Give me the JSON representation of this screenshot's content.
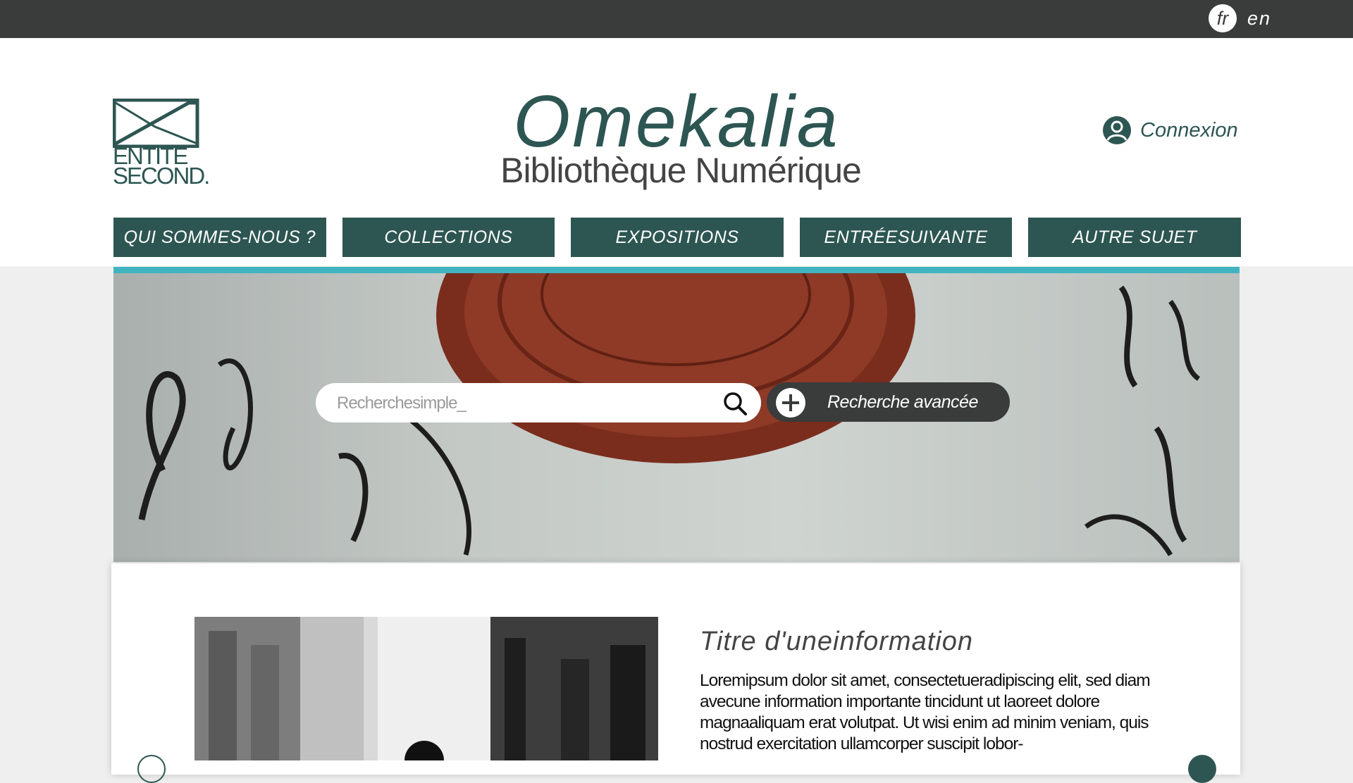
{
  "topbar": {
    "languages": [
      "fr",
      "en"
    ],
    "active_language": "fr"
  },
  "header": {
    "logo": {
      "line1": "ENTITE",
      "line2": "SECOND."
    },
    "title": "Omekalia",
    "subtitle": "Bibliothèque Numérique",
    "login_label": "Connexion"
  },
  "nav": {
    "items": [
      "QUI SOMMES-NOUS ?",
      "COLLECTIONS",
      "EXPOSITIONS",
      "ENTRÉESUIVANTE",
      "AUTRE SUJET"
    ]
  },
  "search": {
    "placeholder": "Recherchesimple_",
    "advanced_label": "Recherche avancée"
  },
  "news": {
    "title": "Titre d'uneinformation",
    "body": "Loremipsum dolor sit amet, consectetueradipiscing elit,  sed diam avecune information  importante  tincidunt  ut laoreet dolore magnaaliquam erat volutpat. Ut wisi  enim ad minim veniam, quis nostrud exercitation  ullamcorper suscipit lobor-"
  },
  "colors": {
    "brand": "#2d5652",
    "accent": "#3fb4c0",
    "topbar": "#3a3b3b"
  },
  "icons": {
    "login": "user-circle-icon",
    "search": "search-icon",
    "advanced": "plus-circle-icon"
  }
}
